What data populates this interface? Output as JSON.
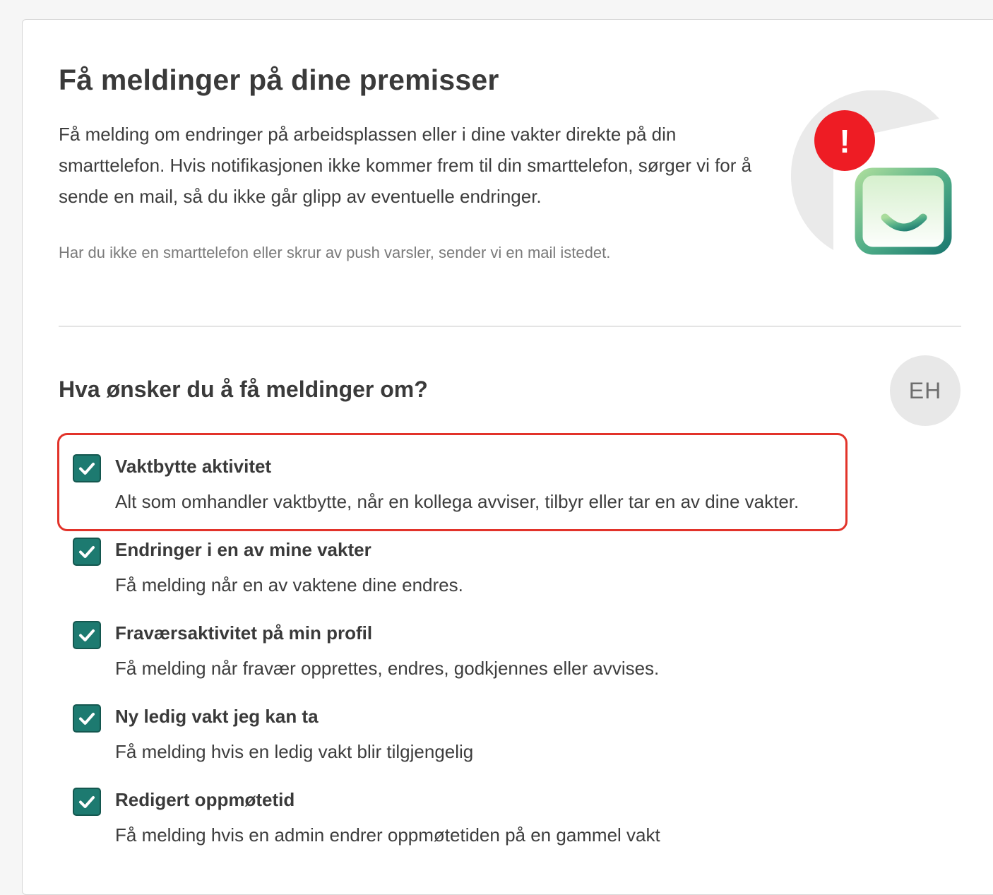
{
  "header": {
    "title": "Få meldinger på dine premisser",
    "intro": "Få melding om endringer på arbeidsplassen eller i dine vakter direkte på din smarttelefon. Hvis notifikasjonen ikke kommer frem til din smarttelefon, sørger vi for å sende en mail, så du ikke går glipp av eventuelle endringer.",
    "note": "Har du ikke en smarttelefon eller skrur av push varsler, sender vi en mail istedet."
  },
  "illustration": {
    "badge_text": "!",
    "icon": "calendar-smile-icon"
  },
  "section": {
    "title": "Hva ønsker du å få meldinger om?"
  },
  "user": {
    "initials": "EH"
  },
  "options": [
    {
      "label": "Vaktbytte aktivitet",
      "description": "Alt som omhandler vaktbytte, når en kollega avviser, tilbyr eller tar en av dine vakter.",
      "checked": true
    },
    {
      "label": "Endringer i en av mine vakter",
      "description": "Få melding når en av vaktene dine endres.",
      "checked": true
    },
    {
      "label": "Fraværsaktivitet på min profil",
      "description": "Få melding når fravær opprettes, endres, godkjennes eller avvises.",
      "checked": true
    },
    {
      "label": "Ny ledig vakt jeg kan ta",
      "description": "Få melding hvis en ledig vakt blir tilgjengelig",
      "checked": true
    },
    {
      "label": "Redigert oppmøtetid",
      "description": "Få melding hvis en admin endrer oppmøtetiden på en gammel vakt",
      "checked": true
    }
  ],
  "colors": {
    "accent": "#1d7a70",
    "highlight": "#e2332a",
    "badge": "#ee1c24"
  }
}
